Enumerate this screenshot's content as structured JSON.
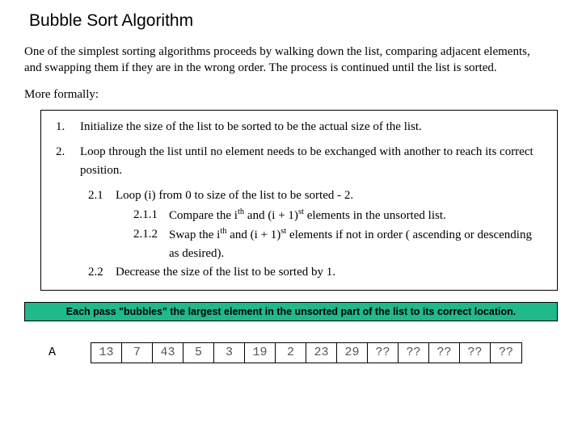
{
  "title": "Bubble Sort Algorithm",
  "intro": "One of the simplest sorting algorithms proceeds by walking down the list, comparing adjacent elements, and swapping them if they are in the wrong order.  The process is continued until the list is sorted.",
  "formal_label": "More formally:",
  "steps": {
    "s1": {
      "num": "1.",
      "txt": "Initialize the size of the list to be sorted to be the actual size of the list."
    },
    "s2": {
      "num": "2.",
      "txt": "Loop through the list until no element needs to be exchanged with another to reach its correct position."
    },
    "s2_1": {
      "num": "2.1",
      "txt": "Loop (i) from 0 to size of the list to be sorted - 2."
    },
    "s2_1_1": {
      "num": "2.1.1",
      "pre": "Compare the i",
      "sup1": "th",
      "mid": " and (i + 1)",
      "sup2": "st",
      "post": " elements in the unsorted list."
    },
    "s2_1_2": {
      "num": "2.1.2",
      "pre": "Swap the i",
      "sup1": "th",
      "mid": " and (i + 1)",
      "sup2": "st",
      "post": " elements if not in order ( ascending or descending as desired)."
    },
    "s2_2": {
      "num": "2.2",
      "txt": "Decrease the size of the list to be sorted by 1."
    }
  },
  "highlight": "Each pass \"bubbles\" the largest element in the unsorted part of the list to its correct location.",
  "array": {
    "label": "A",
    "cells": [
      "13",
      "7",
      "43",
      "5",
      "3",
      "19",
      "2",
      "23",
      "29",
      "??",
      "??",
      "??",
      "??",
      "??"
    ]
  }
}
